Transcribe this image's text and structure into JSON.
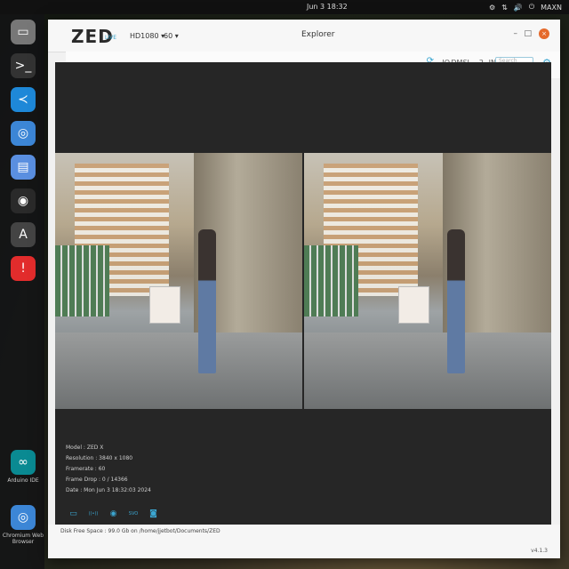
{
  "system": {
    "clock": "Jun 3  18:32",
    "tray": [
      "⚙",
      "⇅",
      "🔊",
      "⏻",
      "MAXN"
    ]
  },
  "dock": {
    "items": [
      {
        "icon": "folder-icon",
        "glyph": "▭",
        "color": "#777777",
        "label": ""
      },
      {
        "icon": "terminal-icon",
        "glyph": ">_",
        "color": "#333333",
        "label": ""
      },
      {
        "icon": "vscode-icon",
        "glyph": "≺",
        "color": "#1e88d8",
        "label": ""
      },
      {
        "icon": "chromium-icon",
        "glyph": "◎",
        "color": "#3c86d6",
        "label": ""
      },
      {
        "icon": "text-editor-icon",
        "glyph": "▤",
        "color": "#5a8fe0",
        "label": ""
      },
      {
        "icon": "obs-icon",
        "glyph": "◉",
        "color": "#2a2a2a",
        "label": ""
      },
      {
        "icon": "accessibility-icon",
        "glyph": "A",
        "color": "#444444",
        "label": ""
      },
      {
        "icon": "help-icon",
        "glyph": "!",
        "color": "#e22c2c",
        "label": ""
      },
      {
        "icon": "arduino-icon",
        "glyph": "∞",
        "color": "#0a8a92",
        "label": "Arduino IDE"
      },
      {
        "icon": "chromium-browser-icon",
        "glyph": "◎",
        "color": "#3c86d6",
        "label": "Chromium Web Browser"
      }
    ]
  },
  "window": {
    "logo": "ZED",
    "live": "LIVE",
    "resolution": "HD1080",
    "fps": "60",
    "title": "Explorer",
    "minimize": "–",
    "maximize": "□",
    "close": "×"
  },
  "toolbar": {
    "sync_icon": "⟳",
    "mode": "IO",
    "depth": "DMSL",
    "value": "2",
    "unit": "IN",
    "search_placeholder": "Search",
    "settings_icon": "⚙"
  },
  "camera_info": {
    "model": "Model : ZED X",
    "resolution": "Resolution : 3840 x 1080",
    "framerate": "Framerate : 60",
    "frame_drop": "Frame Drop : 0 / 14366",
    "date": "Date : Mon Jun 3 18:32:03 2024"
  },
  "bottom_icons": [
    {
      "name": "folder-icon",
      "glyph": "▭"
    },
    {
      "name": "stream-icon",
      "glyph": "((•))"
    },
    {
      "name": "record-icon",
      "glyph": "◉"
    },
    {
      "name": "svo-icon",
      "glyph": "SVO"
    },
    {
      "name": "snapshot-icon",
      "glyph": "◙"
    }
  ],
  "status": {
    "disk": "Disk Free Space : 99.0 Gb  on  /home/jjetbot/Documents/ZED",
    "version": "v4.1.3"
  },
  "colors": {
    "accent": "#3ba6d1",
    "close": "#e56a2c"
  }
}
